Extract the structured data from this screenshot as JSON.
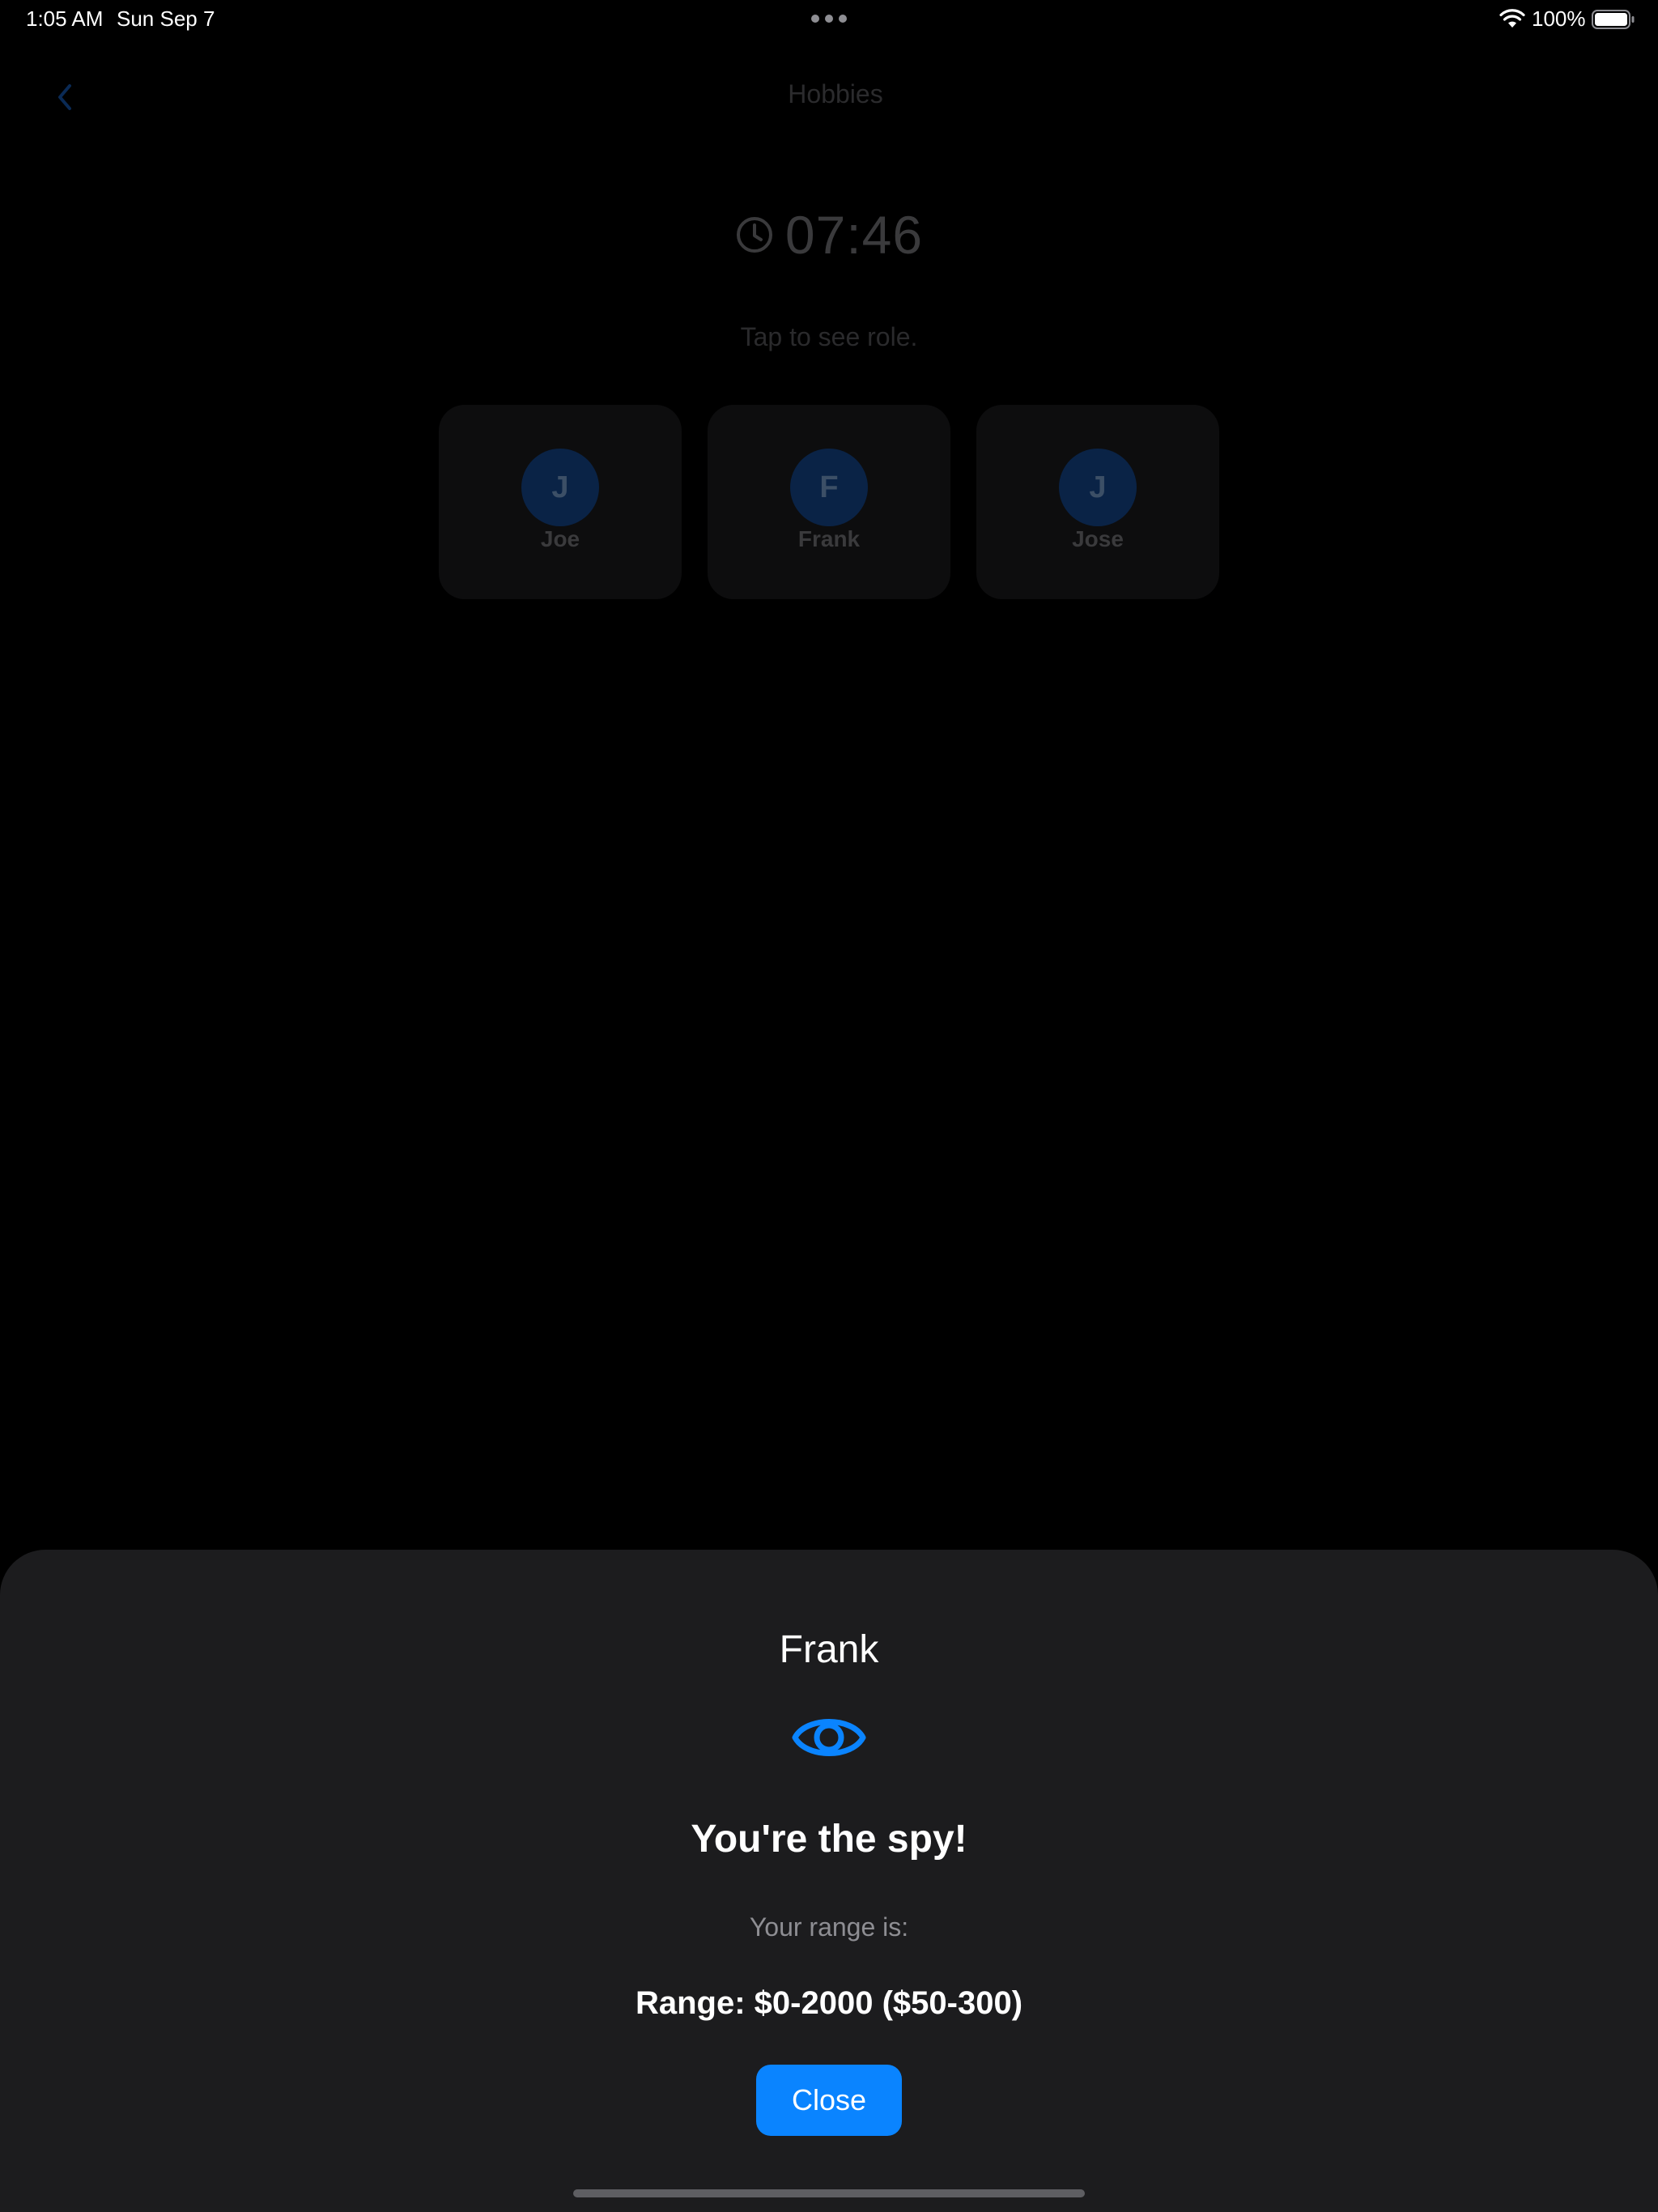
{
  "status_bar": {
    "time": "1:05 AM",
    "date": "Sun Sep 7",
    "battery": "100%",
    "icons": [
      "wifi-icon",
      "battery-icon",
      "multitask-dots"
    ]
  },
  "nav": {
    "title": "Hobbies",
    "back_icon": "chevron-left-icon"
  },
  "timer": {
    "icon": "clock-icon",
    "value": "07:46"
  },
  "hint": "Tap to see role.",
  "players": [
    {
      "initial": "J",
      "name": "Joe"
    },
    {
      "initial": "F",
      "name": "Frank"
    },
    {
      "initial": "J",
      "name": "Jose"
    }
  ],
  "sheet": {
    "player_name": "Frank",
    "icon": "eye-icon",
    "role_title": "You're the spy!",
    "range_label": "Your range is:",
    "range_value": "Range: $0-2000 ($50-300)",
    "close_label": "Close"
  },
  "colors": {
    "accent": "#0a84ff",
    "sheet_background": "#1c1c1e",
    "background": "#000000"
  }
}
